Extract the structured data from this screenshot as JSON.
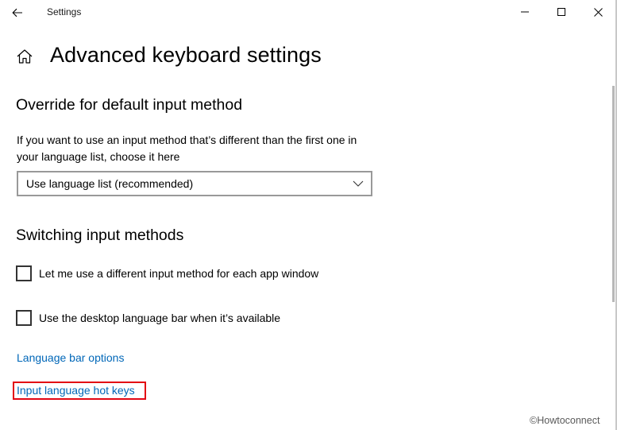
{
  "window": {
    "title": "Settings",
    "back_icon": "back-arrow-icon",
    "controls": {
      "minimize": "minimize-icon",
      "maximize": "maximize-icon",
      "close": "close-icon"
    }
  },
  "page": {
    "home_icon": "home-icon",
    "title": "Advanced keyboard settings"
  },
  "override": {
    "heading": "Override for default input method",
    "description": "If you want to use an input method that’s different than the first one in your language list, choose it here",
    "dropdown_value": "Use language list (recommended)"
  },
  "switching": {
    "heading": "Switching input methods",
    "checkbox1_label": "Let me use a different input method for each app window",
    "checkbox1_checked": false,
    "checkbox2_label": "Use the desktop language bar when it’s available",
    "checkbox2_checked": false
  },
  "links": {
    "language_bar": "Language bar options",
    "hot_keys": "Input language hot keys"
  },
  "highlight_color": "#e30613",
  "accent_color": "#0067b8",
  "watermark": "©Howtoconnect"
}
